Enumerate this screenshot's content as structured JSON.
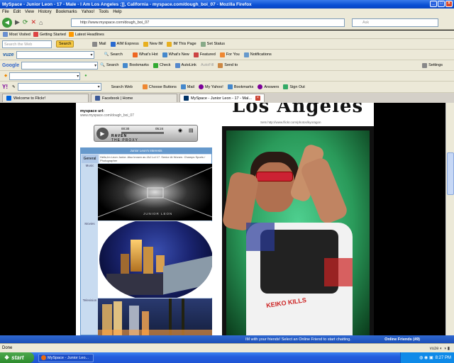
{
  "window": {
    "title": "MySpace - Junior Leon - 17 - Male - I Am Los Angeles ;]], California - myspace.com/dough_boi_07 - Mozilla Firefox"
  },
  "menu": [
    "File",
    "Edit",
    "View",
    "History",
    "Bookmarks",
    "Yahoo!",
    "Tools",
    "Help"
  ],
  "nav": {
    "url": "http://www.myspace.com/dough_boi_07",
    "search_placeholder": "Ask"
  },
  "bookmarks": [
    "Most Visited",
    "Getting Started",
    "Latest Headlines"
  ],
  "toolbar1": {
    "search_placeholder": "Search the Web",
    "search_btn": "Search",
    "items": [
      "Mail",
      "AIM Express",
      "New IM",
      "IM This Page",
      "Set Status"
    ]
  },
  "toolbar2": {
    "brand": "vuze",
    "items": [
      "Search",
      "What's Hot",
      "What's New",
      "Featured",
      "For You",
      "Notifications"
    ]
  },
  "toolbar3": {
    "brand": "Google",
    "items": [
      "Search",
      "Bookmarks",
      "Check",
      "AutoLink",
      "AutoFill",
      "Send to"
    ],
    "settings": "Settings"
  },
  "toolbar5": {
    "brand": "Y!",
    "items": [
      "Search Web",
      "Choose Buttons",
      "Mail",
      "My Yahoo!",
      "Bookmarks",
      "Answers",
      "Sign Out"
    ]
  },
  "tabs": [
    {
      "label": "Welcome to Flickr!"
    },
    {
      "label": "Facebook | Home"
    },
    {
      "label": "MySpace - Junior Leon - 17 - Mal..."
    }
  ],
  "profile": {
    "url_label": "myspace url:",
    "url": "www.myspace.com/dough_boi_07",
    "player": {
      "time_elapsed": "00:30",
      "time_total": "05:24",
      "artist": "RAVEN",
      "song": "THE PROXY"
    },
    "interests_header": "Junior Leon's Interests",
    "general_label": "General",
    "general_text": "Hello,Im Leon Junior. Also known as JAJ Lol 17. Senior At Wonen. Champs Sports / Photographer",
    "rows": [
      {
        "label": "Music",
        "caption": "JUNIOR LEON"
      },
      {
        "label": "Movies"
      },
      {
        "label": "Television"
      }
    ],
    "banner": "Los Angeles",
    "photo_credit": "Sets http://www.flickr.com/photos/kyoragon",
    "shirt_text": "KEIKO KILLS"
  },
  "imbar": {
    "message": "IM with your friends! Select an Online Friend to start chatting.",
    "friends": "Online Friends (49)"
  },
  "status": {
    "text": "Done"
  },
  "taskbar": {
    "start": "start",
    "task": "MySpace - Junior Leo...",
    "clock": "8:27 PM"
  }
}
